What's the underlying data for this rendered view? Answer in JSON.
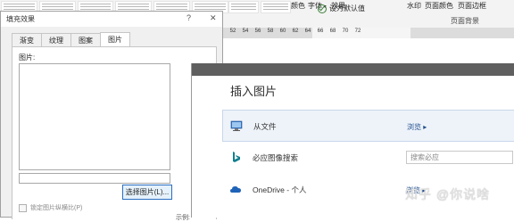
{
  "ribbon": {
    "color_label": "颜色",
    "font_label": "字体",
    "effects_label": "效果",
    "set_default_label": "设为默认值",
    "watermark_label": "水印",
    "page_color_label": "页面颜色",
    "page_border_label": "页面边框",
    "group_label": "页面背景"
  },
  "ruler": {
    "ticks": [
      "52",
      "54",
      "56",
      "58",
      "60",
      "62",
      "64",
      "66",
      "68",
      "70",
      "72"
    ]
  },
  "dialog": {
    "title": "填充效果",
    "help": "?",
    "close": "✕",
    "tabs": [
      "渐变",
      "纹理",
      "图案",
      "图片"
    ],
    "active_tab": "图片",
    "picture_label": "图片:",
    "select_button": "选择图片(L)...",
    "lock_label": "锁定图片纵横比(P)",
    "partial_text": "示例:"
  },
  "insert": {
    "title": "插入图片",
    "rows": [
      {
        "label": "从文件",
        "action": "浏览 ▸"
      },
      {
        "label": "必应图像搜索",
        "placeholder": "搜索必应"
      },
      {
        "label": "OneDrive - 个人",
        "action": "浏览 ▸"
      }
    ]
  },
  "watermark_text": "知乎 @你说啥"
}
